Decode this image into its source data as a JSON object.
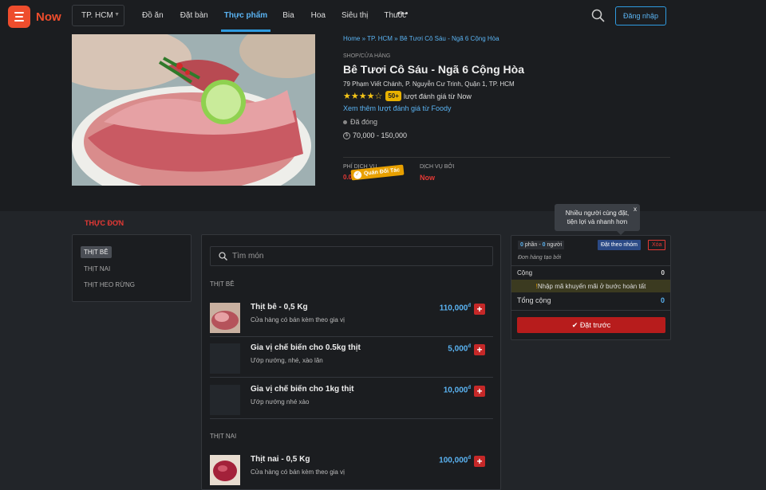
{
  "brand": {
    "name": "Now",
    "color": "#ee4d2d"
  },
  "city": {
    "selected": "TP. HCM"
  },
  "nav": [
    {
      "label": "Đồ ăn"
    },
    {
      "label": "Đặt bàn"
    },
    {
      "label": "Thực phẩm",
      "active": true
    },
    {
      "label": "Bia"
    },
    {
      "label": "Hoa"
    },
    {
      "label": "Siêu thị"
    },
    {
      "label": "Thuốc"
    }
  ],
  "header": {
    "search_icon": "search-icon",
    "login_label": "Đăng nhập"
  },
  "store": {
    "breadcrumb": "Home » TP. HCM » Bê Tươi Cô Sáu - Ngã 6 Cộng Hòa",
    "kind": "SHOP/CỬA HÀNG",
    "name": "Bê Tươi Cô Sáu - Ngã 6 Cộng Hòa",
    "address": "79 Phạm Viết Chánh, P. Nguyễn Cư Trinh, Quận 1, TP. HCM",
    "rating_badge": "50+",
    "rating_text": "lượt đánh giá từ Now",
    "more_reviews": "Xem thêm lượt đánh giá từ Foody",
    "status": "Đã đóng",
    "price_range": "70,000 - 150,000",
    "fee_label": "PHÍ DỊCH VỤ",
    "fee_value": "0.0",
    "partner_label": "Quán Đối Tác",
    "service_label": "DỊCH VỤ BỞI",
    "service_value": "Now"
  },
  "menu": {
    "title": "THỰC ĐƠN",
    "categories": [
      {
        "label": "THỊT BÊ",
        "active": true
      },
      {
        "label": "THỊT NAI"
      },
      {
        "label": "THỊT HEO RỪNG"
      }
    ],
    "search_placeholder": "Tìm món",
    "sections": [
      {
        "title": "THỊT BÊ",
        "items": [
          {
            "name": "Thịt bê - 0,5 Kg",
            "desc": "Cửa hàng có bán kèm theo gia vị",
            "price": "110,000"
          },
          {
            "name": "Gia vị chế biến cho 0.5kg thịt",
            "desc": "Ướp nướng, nhé, xào lăn",
            "price": "5,000"
          },
          {
            "name": "Gia vị chế biến cho 1kg thịt",
            "desc": "Ướp nướng nhé xào",
            "price": "10,000"
          }
        ]
      },
      {
        "title": "THỊT NAI",
        "items": [
          {
            "name": "Thịt nai - 0,5 Kg",
            "desc": "Cửa hàng có bán kèm theo gia vị",
            "price": "100,000"
          }
        ]
      }
    ],
    "currency": "đ"
  },
  "cart": {
    "portions": "0",
    "portions_label": "phần",
    "people": "0",
    "people_label": "người",
    "group_button": "Đặt theo nhóm",
    "delete_button": "Xóa",
    "by_label": "Đơn hàng tạo bởi",
    "subtotal_label": "Cộng",
    "subtotal_value": "0",
    "promo_text": "Nhập mã khuyến mãi ở bước hoàn tất",
    "total_label": "Tổng cộng",
    "total_value": "0",
    "order_button": "Đặt trước"
  },
  "tooltip": {
    "text_line1": "Nhiều người cùng đặt,",
    "text_line2": "tiện lợi và nhanh hơn",
    "close": "x"
  }
}
